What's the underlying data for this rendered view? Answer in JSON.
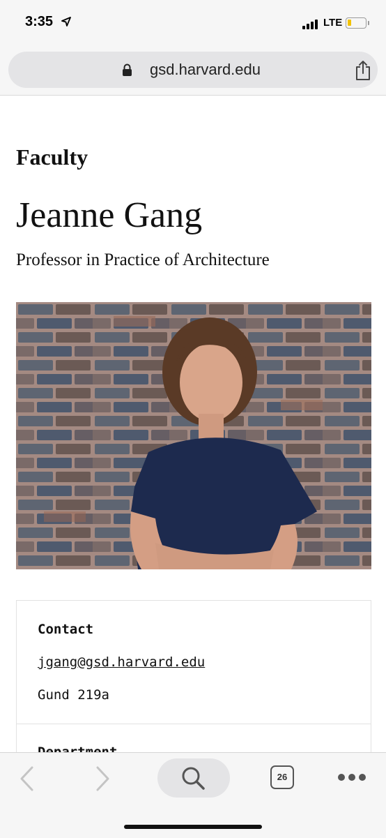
{
  "status_bar": {
    "time": "3:35",
    "network": "LTE",
    "battery_level": 0.2,
    "battery_color": "#f2c200"
  },
  "browser": {
    "url": "gsd.harvard.edu",
    "tab_count": "26"
  },
  "profile": {
    "section": "Faculty",
    "name": "Jeanne Gang",
    "title": "Professor in Practice of Architecture",
    "contact": {
      "heading": "Contact",
      "email": "jgang@gsd.harvard.edu",
      "office": "Gund 219a"
    },
    "department_heading": "Department"
  },
  "icons": [
    "location-arrow-icon",
    "signal-icon",
    "battery-icon",
    "lock-icon",
    "share-icon",
    "back-icon",
    "forward-icon",
    "search-icon",
    "tabs-icon",
    "more-icon"
  ]
}
